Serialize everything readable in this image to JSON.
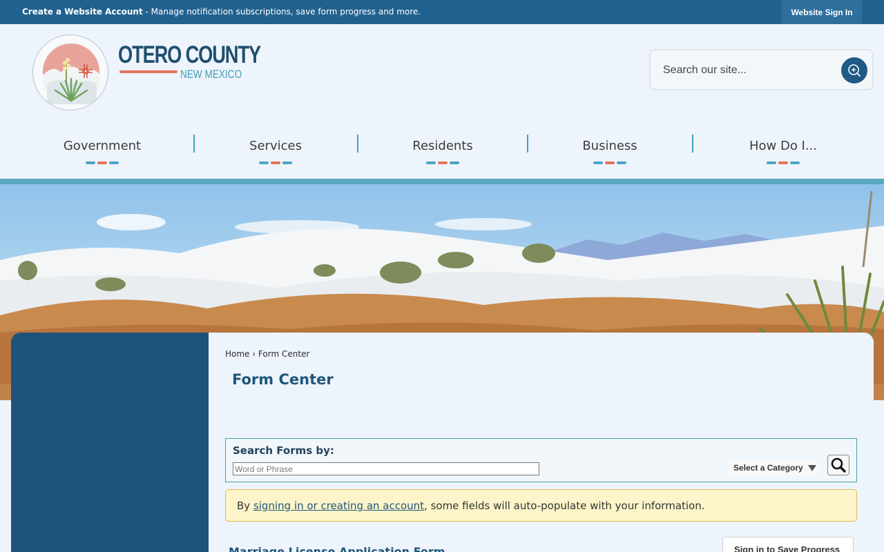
{
  "topbar": {
    "create_account_strong": "Create a Website Account",
    "create_account_rest": " - Manage notification subscriptions, save form progress and more.",
    "signin_label": "Website Sign In"
  },
  "logo": {
    "title": "OTERO COUNTY",
    "subtitle": "NEW MEXICO"
  },
  "search": {
    "placeholder": "Search our site..."
  },
  "nav": {
    "items": [
      {
        "label": "Government"
      },
      {
        "label": "Services"
      },
      {
        "label": "Residents"
      },
      {
        "label": "Business"
      },
      {
        "label": "How Do I..."
      }
    ]
  },
  "breadcrumb": {
    "home": "Home",
    "separator": "›",
    "current": "Form Center"
  },
  "page": {
    "title": "Form Center"
  },
  "form_search": {
    "label": "Search Forms by:",
    "placeholder": "Word or Phrase",
    "category_label": "Select a Category"
  },
  "notice": {
    "prefix": "By ",
    "link": "signing in or creating an account",
    "suffix": ", some fields will auto-populate with your information."
  },
  "form": {
    "title": "Marriage License Application Form",
    "save_label": "Sign in to Save Progress"
  },
  "colors": {
    "topbar": "#21618f",
    "sidebar": "#1e5379",
    "accent_teal": "#56a8c0",
    "accent_coral": "#e2735f",
    "notice_bg": "#fdf5c9"
  }
}
